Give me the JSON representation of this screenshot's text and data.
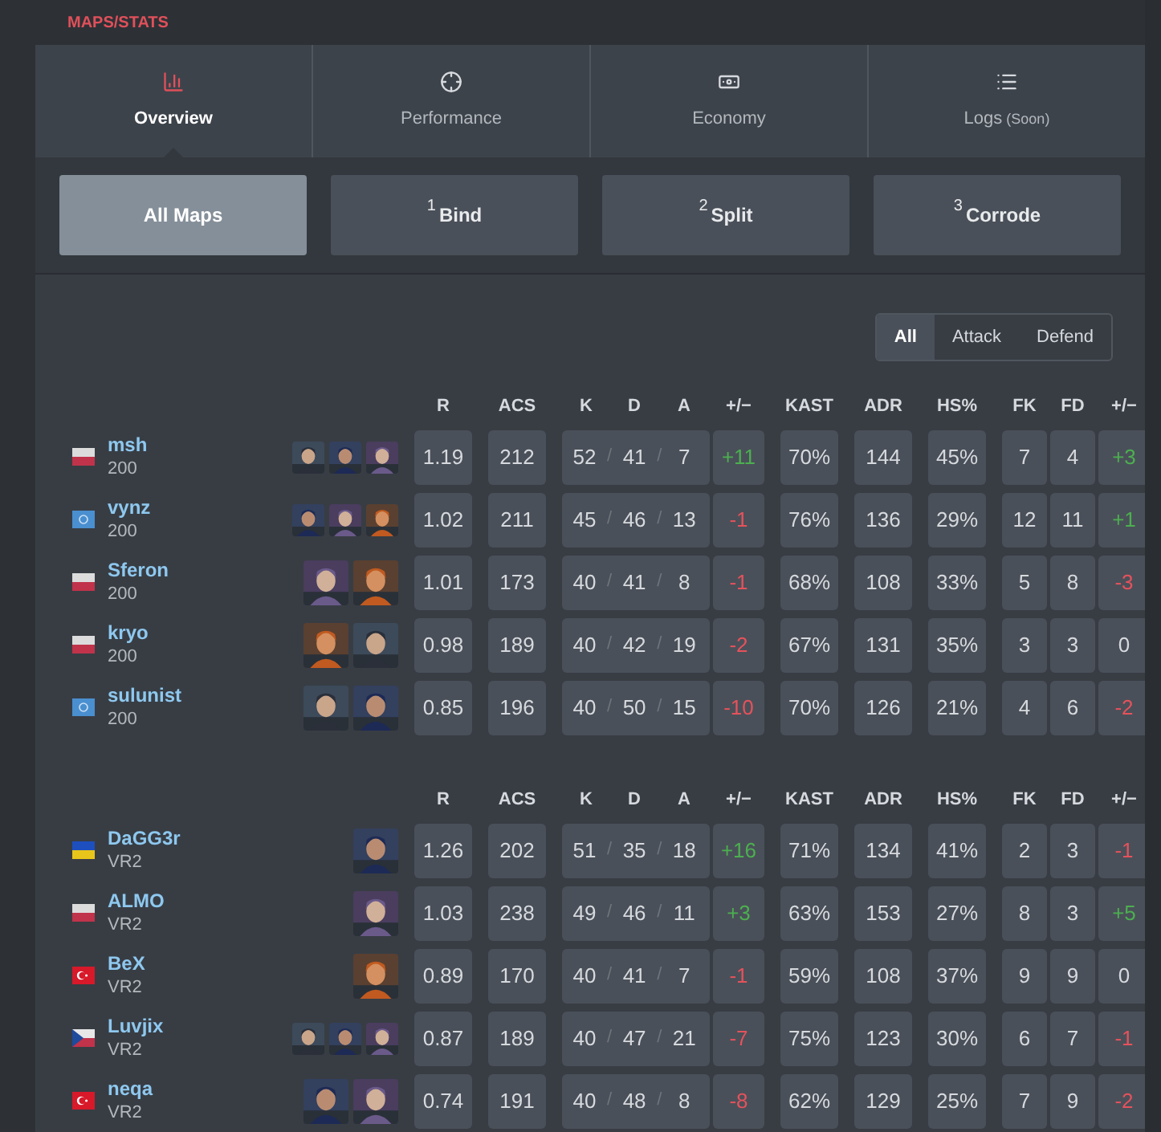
{
  "section_title": "MAPS/STATS",
  "tabs": [
    {
      "label": "Overview",
      "selected": true
    },
    {
      "label": "Performance",
      "selected": false
    },
    {
      "label": "Economy",
      "selected": false
    },
    {
      "label": "Logs",
      "note": "(Soon)",
      "selected": false
    }
  ],
  "maps": [
    {
      "name": "All Maps",
      "selected": true
    },
    {
      "number": "1",
      "name": "Bind",
      "selected": false
    },
    {
      "number": "2",
      "name": "Split",
      "selected": false
    },
    {
      "number": "3",
      "name": "Corrode",
      "selected": false
    }
  ],
  "side_filter": [
    {
      "label": "All",
      "selected": true
    },
    {
      "label": "Attack",
      "selected": false
    },
    {
      "label": "Defend",
      "selected": false
    }
  ],
  "teams": [
    {
      "columns": [
        "R",
        "ACS",
        "K",
        "D",
        "A",
        "+/−",
        "KAST",
        "ADR",
        "HS%",
        "FK",
        "FD",
        "+/−"
      ],
      "players": [
        {
          "name": "msh",
          "team": "200",
          "flag": {
            "kind": "pl"
          },
          "r": "1.19",
          "acs": "212",
          "kda": [
            "52",
            "/",
            "41",
            "/",
            "7"
          ],
          "kd_diff": {
            "value": "+11",
            "color": "#4caf50"
          },
          "kast": "70%",
          "adr": "144",
          "hs": "45%",
          "fk": "7",
          "fd": "4",
          "fk_diff": {
            "value": "+3",
            "color": "#4caf50"
          }
        },
        {
          "name": "vynz",
          "team": "200",
          "flag": {
            "kind": "un"
          },
          "r": "1.02",
          "acs": "211",
          "kda": [
            "45",
            "/",
            "46",
            "/",
            "13"
          ],
          "kd_diff": {
            "value": "-1",
            "color": "#e5525c"
          },
          "kast": "76%",
          "adr": "136",
          "hs": "29%",
          "fk": "12",
          "fd": "11",
          "fk_diff": {
            "value": "+1",
            "color": "#4caf50"
          }
        },
        {
          "name": "Sferon",
          "team": "200",
          "flag": {
            "kind": "pl"
          },
          "r": "1.01",
          "acs": "173",
          "kda": [
            "40",
            "/",
            "41",
            "/",
            "8"
          ],
          "kd_diff": {
            "value": "-1",
            "color": "#e5525c"
          },
          "kast": "68%",
          "adr": "108",
          "hs": "33%",
          "fk": "5",
          "fd": "8",
          "fk_diff": {
            "value": "-3",
            "color": "#e5525c"
          }
        },
        {
          "name": "kryo",
          "team": "200",
          "flag": {
            "kind": "pl"
          },
          "r": "0.98",
          "acs": "189",
          "kda": [
            "40",
            "/",
            "42",
            "/",
            "19"
          ],
          "kd_diff": {
            "value": "-2",
            "color": "#e5525c"
          },
          "kast": "67%",
          "adr": "131",
          "hs": "35%",
          "fk": "3",
          "fd": "3",
          "fk_diff": {
            "value": "0",
            "color": "#d6d9dd"
          }
        },
        {
          "name": "sulunist",
          "team": "200",
          "flag": {
            "kind": "un"
          },
          "r": "0.85",
          "acs": "196",
          "kda": [
            "40",
            "/",
            "50",
            "/",
            "15"
          ],
          "kd_diff": {
            "value": "-10",
            "color": "#e5525c"
          },
          "kast": "70%",
          "adr": "126",
          "hs": "21%",
          "fk": "4",
          "fd": "6",
          "fk_diff": {
            "value": "-2",
            "color": "#e5525c"
          }
        }
      ]
    },
    {
      "columns": [
        "R",
        "ACS",
        "K",
        "D",
        "A",
        "+/−",
        "KAST",
        "ADR",
        "HS%",
        "FK",
        "FD",
        "+/−"
      ],
      "players": [
        {
          "name": "DaGG3r",
          "team": "VR2",
          "flag": {
            "kind": "ua"
          },
          "r": "1.26",
          "acs": "202",
          "kda": [
            "51",
            "/",
            "35",
            "/",
            "18"
          ],
          "kd_diff": {
            "value": "+16",
            "color": "#4caf50"
          },
          "kast": "71%",
          "adr": "134",
          "hs": "41%",
          "fk": "2",
          "fd": "3",
          "fk_diff": {
            "value": "-1",
            "color": "#e5525c"
          }
        },
        {
          "name": "ALMO",
          "team": "VR2",
          "flag": {
            "kind": "pl"
          },
          "r": "1.03",
          "acs": "238",
          "kda": [
            "49",
            "/",
            "46",
            "/",
            "11"
          ],
          "kd_diff": {
            "value": "+3",
            "color": "#4caf50"
          },
          "kast": "63%",
          "adr": "153",
          "hs": "27%",
          "fk": "8",
          "fd": "3",
          "fk_diff": {
            "value": "+5",
            "color": "#4caf50"
          }
        },
        {
          "name": "BeX",
          "team": "VR2",
          "flag": {
            "kind": "tr"
          },
          "r": "0.89",
          "acs": "170",
          "kda": [
            "40",
            "/",
            "41",
            "/",
            "7"
          ],
          "kd_diff": {
            "value": "-1",
            "color": "#e5525c"
          },
          "kast": "59%",
          "adr": "108",
          "hs": "37%",
          "fk": "9",
          "fd": "9",
          "fk_diff": {
            "value": "0",
            "color": "#d6d9dd"
          }
        },
        {
          "name": "Luvjix",
          "team": "VR2",
          "flag": {
            "kind": "cz"
          },
          "r": "0.87",
          "acs": "189",
          "kda": [
            "40",
            "/",
            "47",
            "/",
            "21"
          ],
          "kd_diff": {
            "value": "-7",
            "color": "#e5525c"
          },
          "kast": "75%",
          "adr": "123",
          "hs": "30%",
          "fk": "6",
          "fd": "7",
          "fk_diff": {
            "value": "-1",
            "color": "#e5525c"
          }
        },
        {
          "name": "neqa",
          "team": "VR2",
          "flag": {
            "kind": "tr"
          },
          "r": "0.74",
          "acs": "191",
          "kda": [
            "40",
            "/",
            "48",
            "/",
            "8"
          ],
          "kd_diff": {
            "value": "-8",
            "color": "#e5525c"
          },
          "kast": "62%",
          "adr": "129",
          "hs": "25%",
          "fk": "7",
          "fd": "9",
          "fk_diff": {
            "value": "-2",
            "color": "#e5525c"
          }
        }
      ]
    }
  ]
}
